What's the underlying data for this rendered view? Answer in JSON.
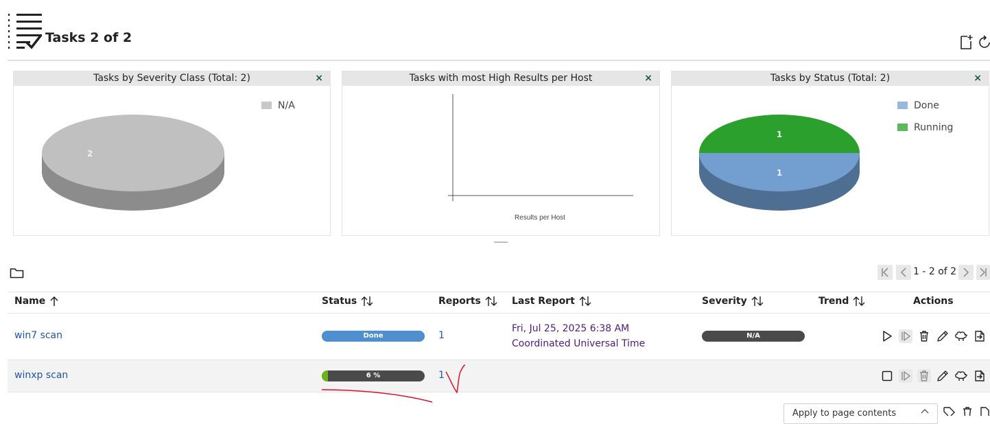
{
  "header": {
    "title": "Tasks 2 of 2",
    "icons": [
      "task-list-icon",
      "new-task-icon",
      "refresh-icon"
    ]
  },
  "dashboard": {
    "panels": [
      {
        "title": "Tasks by Severity Class (Total: 2)",
        "close": "×",
        "chart_data": {
          "type": "pie",
          "categories": [
            "N/A"
          ],
          "values": [
            2
          ],
          "colors": [
            "#c0c0c0"
          ],
          "legend": [
            "N/A"
          ]
        }
      },
      {
        "title": "Tasks with most High Results per Host",
        "close": "×",
        "chart_data": {
          "type": "bar",
          "categories": [],
          "values": [],
          "xlabel": "Results per Host"
        }
      },
      {
        "title": "Tasks by Status (Total: 2)",
        "close": "×",
        "chart_data": {
          "type": "pie",
          "categories": [
            "Done",
            "Running"
          ],
          "values": [
            1,
            1
          ],
          "colors": [
            "#729fcf",
            "#2ca02c"
          ],
          "legend": [
            "Done",
            "Running"
          ]
        }
      }
    ]
  },
  "pagination": {
    "text": "1 - 2 of 2",
    "icons": [
      "first-page-icon",
      "previous-page-icon",
      "next-page-icon",
      "last-page-icon"
    ]
  },
  "table": {
    "headers": [
      "Name",
      "Status",
      "Reports",
      "Last Report",
      "Severity",
      "Trend",
      "Actions"
    ],
    "rows": [
      {
        "name": "win7 scan",
        "status": "Done",
        "status_progress": 1.0,
        "reports": "1",
        "last_report_date": "Fri, Jul 25, 2025 6:38 AM",
        "last_report_tz": "Coordinated Universal Time",
        "severity": "N/A"
      },
      {
        "name": "winxp scan",
        "status": "6 %",
        "status_progress": 0.06,
        "reports": "1",
        "last_report_date": "",
        "last_report_tz": "",
        "severity": ""
      }
    ]
  },
  "footer": {
    "apply_select": "Apply to page contents"
  },
  "colors": {
    "link": "#1e56a8",
    "done_bar": "#4f8fcf",
    "progress_track": "#4a4a4a",
    "progress_fill": "#6ab516",
    "severity_na": "#4a4a4a",
    "annotation": "#e0102a"
  }
}
